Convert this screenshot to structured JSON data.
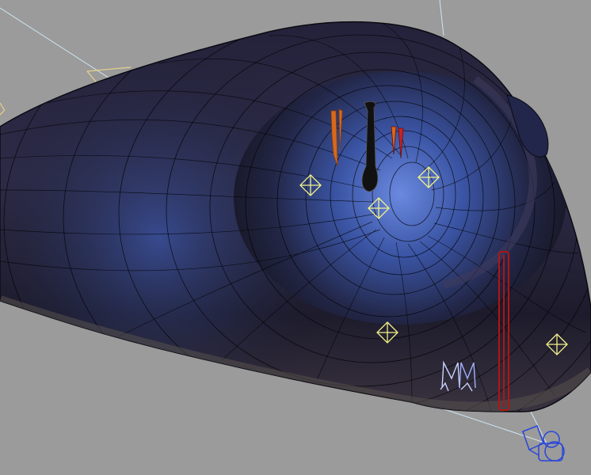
{
  "viewport": {
    "background_color": "#9b9b9b",
    "mesh_color_dark": "#15141f",
    "mesh_color_mid": "#2b2a42",
    "tunnel_glow_color": "#4a6fd0",
    "wireframe_color": "#000000",
    "light_helper_color": "#f2f28a",
    "camera_line_color": "#cfe6f2",
    "camera_color": "#2a46d8",
    "bone_color": "#c9d1ff",
    "light_frame_color": "#e8d28a",
    "stalactite_orange_color": "#d8691c",
    "stalactite_red_color": "#c82222",
    "pillar_red_color": "#b01515",
    "icons": [
      "light-helper-icon",
      "camera-icon",
      "bone-rig-icon",
      "spotlight-icon"
    ]
  }
}
